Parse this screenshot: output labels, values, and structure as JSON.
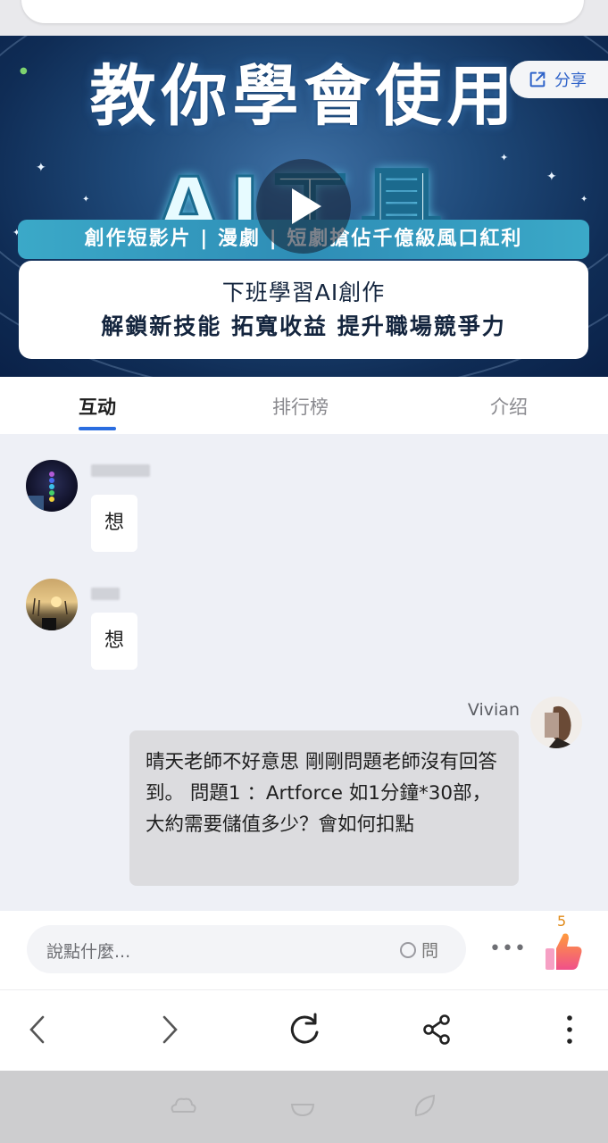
{
  "banner": {
    "title_line1": "教你學會使用",
    "title_line2": "AI工具",
    "ribbon": "創作短影片 | 漫劇 | 短劇搶佔千億級風口紅利",
    "card_line1": "下班學習AI創作",
    "card_line2": "解鎖新技能 拓寬收益 提升職場競爭力",
    "share_label": "分享"
  },
  "tabs": [
    {
      "label": "互动",
      "active": true
    },
    {
      "label": "排行榜",
      "active": false
    },
    {
      "label": "介绍",
      "active": false
    }
  ],
  "chat": {
    "messages": [
      {
        "side": "left",
        "text": "想"
      },
      {
        "side": "left",
        "text": "想"
      },
      {
        "side": "right",
        "user": "Vivian",
        "text": "晴天老師不好意思 剛剛問題老師沒有回答到。 問題1 ：Artforce 如1分鐘*30部，大約需要儲值多少？會如何扣點"
      }
    ]
  },
  "input": {
    "placeholder": "說點什麼...",
    "ask_label": "問",
    "like_count": "5"
  },
  "colors": {
    "accent": "#2a6de0",
    "chat_bg": "#eef0f6",
    "bubble_right": "#dcdcdf"
  }
}
